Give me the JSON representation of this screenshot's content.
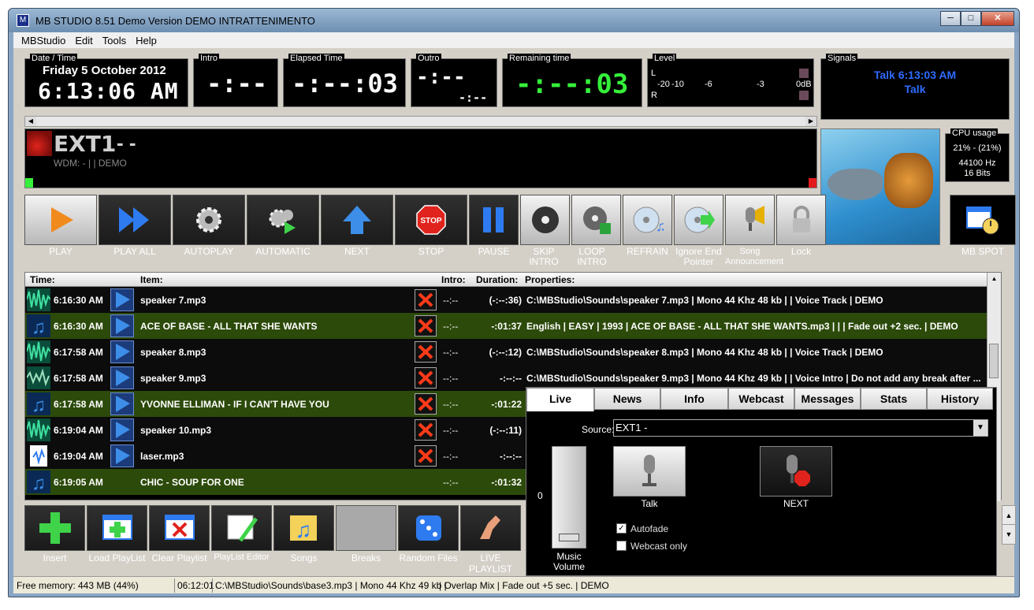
{
  "window": {
    "title": "MB STUDIO  8.51   Demo Version    DEMO    INTRATTENIMENTO",
    "minimize": "─",
    "maximize": "□",
    "close": "✕"
  },
  "menu": [
    "MBStudio",
    "Edit",
    "Tools",
    "Help"
  ],
  "datetime": {
    "label": "Date / Time",
    "date": "Friday 5 October 2012",
    "time": "6:13:06 AM"
  },
  "intro": {
    "label": "Intro",
    "value": "-:--"
  },
  "elapsed": {
    "label": "Elapsed Time",
    "value": "-:--:03"
  },
  "outro": {
    "label": "Outro",
    "value": "-:--",
    "sub": "-:--"
  },
  "remaining": {
    "label": "Remaining time",
    "value": "-:--:03"
  },
  "level": {
    "label": "Level",
    "l": "L",
    "r": "R",
    "scale": [
      "-20",
      "-10",
      "-6",
      "-3",
      "0dB"
    ]
  },
  "signals": {
    "label": "Signals",
    "line1": "Talk 6:13:03 AM",
    "line2": "Talk"
  },
  "cpu": {
    "label": "CPU usage",
    "usage": "21% - (21%)",
    "rate": "44100 Hz",
    "bits": "16 Bits"
  },
  "nowplaying": {
    "title": "EXT1",
    "dashes": "-  -",
    "sub": "WDM: - | | DEMO"
  },
  "toolbar": [
    {
      "name": "play",
      "label": "PLAY"
    },
    {
      "name": "play-all",
      "label": "PLAY ALL"
    },
    {
      "name": "autoplay",
      "label": "AUTOPLAY"
    },
    {
      "name": "automatic",
      "label": "AUTOMATIC"
    },
    {
      "name": "next",
      "label": "NEXT"
    },
    {
      "name": "stop",
      "label": "STOP"
    },
    {
      "name": "pause",
      "label": "PAUSE"
    },
    {
      "name": "skip-intro",
      "label": "SKIP INTRO"
    },
    {
      "name": "loop-intro",
      "label": "LOOP INTRO"
    },
    {
      "name": "refrain",
      "label": "REFRAIN"
    },
    {
      "name": "ignore-end-pointer",
      "label": "Ignore End Pointer"
    },
    {
      "name": "song-announcement",
      "label": "Song Announcement"
    },
    {
      "name": "lock",
      "label": "Lock"
    }
  ],
  "stop_text": "STOP",
  "mbspot": {
    "label": "MB SPOT"
  },
  "playlist": {
    "headers": {
      "time": "Time:",
      "item": "Item:",
      "intro": "Intro:",
      "duration": "Duration:",
      "properties": "Properties:"
    },
    "rows": [
      {
        "time": "6:16:30 AM",
        "item": "speaker 7.mp3",
        "intro": "--:--",
        "duration": "(-:--:36)",
        "properties": "C:\\MBStudio\\Sounds\\speaker 7.mp3 |  Mono 44 Khz 48 kb |  | Voice Track | DEMO",
        "kind": "wave",
        "green": false
      },
      {
        "time": "6:16:30 AM",
        "item": "ACE OF BASE - ALL THAT SHE WANTS",
        "intro": "--:--",
        "duration": "-:01:37",
        "properties": "English | EASY | 1993 | ACE OF BASE - ALL THAT SHE WANTS.mp3 |  |  | Fade out +2 sec. | DEMO",
        "kind": "note",
        "green": true
      },
      {
        "time": "6:17:58 AM",
        "item": "speaker 8.mp3",
        "intro": "--:--",
        "duration": "(-:--:12)",
        "properties": "C:\\MBStudio\\Sounds\\speaker 8.mp3 |  Mono 44 Khz 48 kb |  | Voice Track | DEMO",
        "kind": "wave",
        "green": false
      },
      {
        "time": "6:17:58 AM",
        "item": "speaker 9.mp3",
        "intro": "--:--",
        "duration": "-:--:--",
        "properties": "C:\\MBStudio\\Sounds\\speaker 9.mp3 |  Mono 44 Khz 49 kb |  | Voice Intro | Do not add any break after ...",
        "kind": "wave2",
        "green": false
      },
      {
        "time": "6:17:58 AM",
        "item": "YVONNE ELLIMAN - IF I CAN'T HAVE YOU",
        "intro": "--:--",
        "duration": "-:01:22",
        "properties": "",
        "kind": "note",
        "green": true
      },
      {
        "time": "6:19:04 AM",
        "item": "speaker 10.mp3",
        "intro": "--:--",
        "duration": "(-:--:11)",
        "properties": "",
        "kind": "wave",
        "green": false
      },
      {
        "time": "6:19:04 AM",
        "item": "laser.mp3",
        "intro": "--:--",
        "duration": "-:--:--",
        "properties": "",
        "kind": "doc",
        "green": false
      },
      {
        "time": "6:19:05 AM",
        "item": "CHIC - SOUP FOR ONE",
        "intro": "--:--",
        "duration": "-:01:32",
        "properties": "",
        "kind": "note",
        "green": true
      }
    ]
  },
  "bottom_toolbar": [
    {
      "name": "insert",
      "label": "Insert"
    },
    {
      "name": "load-playlist",
      "label": "Load PlayList"
    },
    {
      "name": "clear-playlist",
      "label": "Clear Playlist"
    },
    {
      "name": "playlist-editor",
      "label": "PlayList Editor"
    },
    {
      "name": "songs",
      "label": "Songs"
    },
    {
      "name": "breaks",
      "label": "Breaks"
    },
    {
      "name": "random-files",
      "label": "Random Files"
    },
    {
      "name": "live-playlist",
      "label": "LIVE PLAYLIST"
    }
  ],
  "live_panel": {
    "tabs": [
      "Live",
      "News",
      "Info",
      "Webcast",
      "Messages",
      "Stats",
      "History"
    ],
    "source_label": "Source:",
    "source_value": "EXT1 -",
    "zero": "0",
    "talk_label": "Talk",
    "next_label": "NEXT",
    "music_volume": "Music Volume",
    "autofade": "Autofade",
    "webcast_only": "Webcast only"
  },
  "status": {
    "memory": "Free memory: 443 MB (44%)",
    "time": "06:12:01",
    "file": "C:\\MBStudio\\Sounds\\base3.mp3 |   Mono 44 Khz 49 kb  |",
    "info": "| Overlap Mix | Fade out +5 sec. | DEMO"
  },
  "colors": {
    "accent_green": "#35f03a",
    "signal_blue": "#2f6bff",
    "row_green": "#2c4a0a"
  }
}
